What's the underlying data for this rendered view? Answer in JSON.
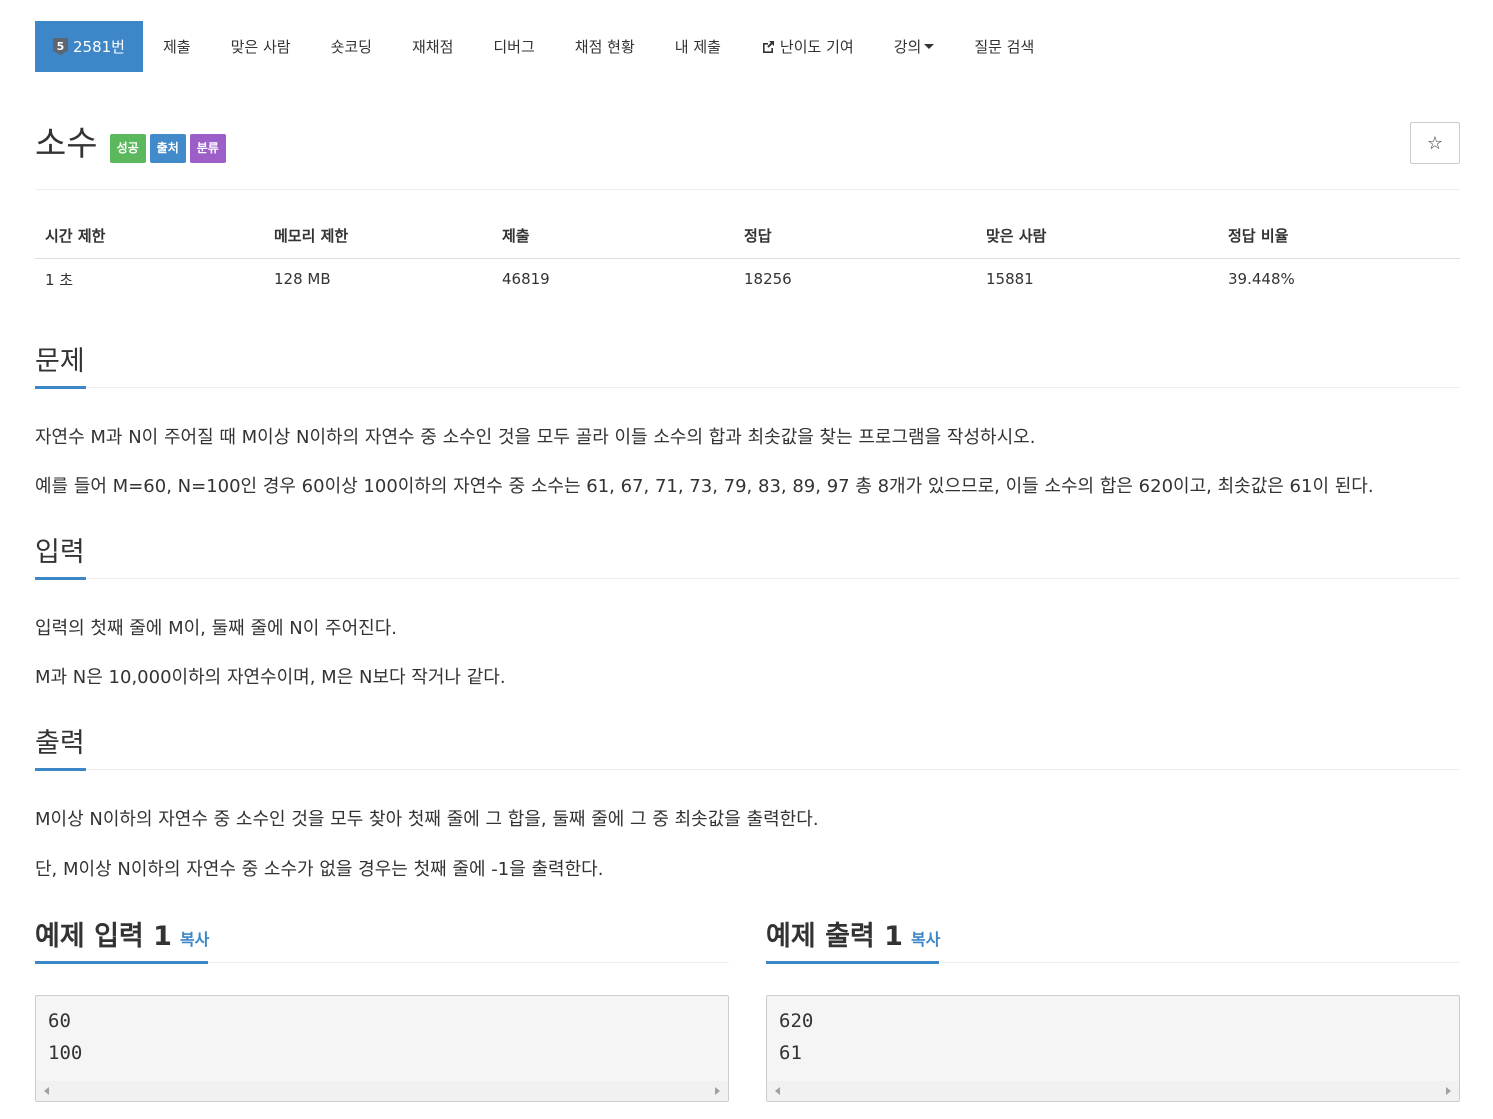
{
  "nav": {
    "problem_tier": "5",
    "problem_label": "2581번",
    "items": [
      "제출",
      "맞은 사람",
      "숏코딩",
      "재채점",
      "디버그",
      "채점 현황",
      "내 제출",
      "난이도 기여",
      "강의",
      "질문 검색"
    ]
  },
  "problem": {
    "title": "소수",
    "labels": {
      "success": "성공",
      "source": "출처",
      "tags": "분류"
    },
    "star": "☆"
  },
  "info_table": {
    "headers": [
      "시간 제한",
      "메모리 제한",
      "제출",
      "정답",
      "맞은 사람",
      "정답 비율"
    ],
    "values": [
      "1 초",
      "128 MB",
      "46819",
      "18256",
      "15881",
      "39.448%"
    ]
  },
  "sections": {
    "description": {
      "heading": "문제",
      "lines": [
        "자연수 M과 N이 주어질 때 M이상 N이하의 자연수 중 소수인 것을 모두 골라 이들 소수의 합과 최솟값을 찾는 프로그램을 작성하시오.",
        "예를 들어 M=60, N=100인 경우 60이상 100이하의 자연수 중 소수는 61, 67, 71, 73, 79, 83, 89, 97 총 8개가 있으므로, 이들 소수의 합은 620이고, 최솟값은 61이 된다."
      ]
    },
    "input": {
      "heading": "입력",
      "lines": [
        "입력의 첫째 줄에 M이, 둘째 줄에 N이 주어진다.",
        "M과 N은 10,000이하의 자연수이며, M은 N보다 작거나 같다."
      ]
    },
    "output": {
      "heading": "출력",
      "lines": [
        "M이상 N이하의 자연수 중 소수인 것을 모두 찾아 첫째 줄에 그 합을, 둘째 줄에 그 중 최솟값을 출력한다.",
        "단, M이상 N이하의 자연수 중 소수가 없을 경우는 첫째 줄에 -1을 출력한다."
      ]
    }
  },
  "samples": {
    "input": {
      "heading": "예제 입력 1",
      "copy": "복사",
      "lines": [
        "60",
        "100"
      ]
    },
    "output": {
      "heading": "예제 출력 1",
      "copy": "복사",
      "lines": [
        "620",
        "61"
      ]
    }
  },
  "colors": {
    "accent": "#3d87c8",
    "success": "#5cb85c",
    "source": "#428bca",
    "tags": "#9c5fc8"
  }
}
